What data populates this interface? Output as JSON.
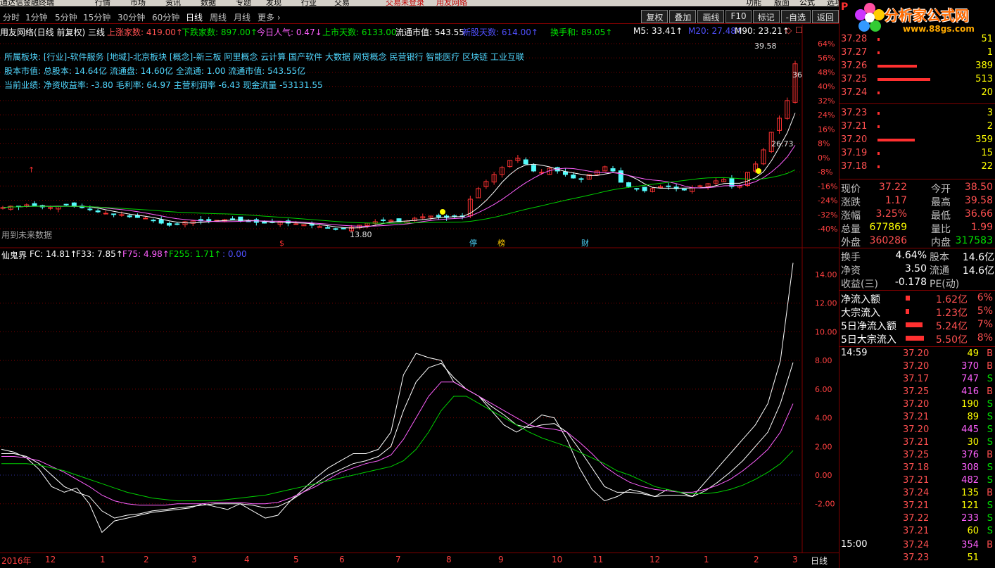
{
  "menubar": {
    "items": [
      {
        "label": "通达信金融终端",
        "color": "#000000"
      },
      {
        "label": "行情",
        "color": "#000000"
      },
      {
        "label": "市场",
        "color": "#000000"
      },
      {
        "label": "资讯",
        "color": "#000000"
      },
      {
        "label": "数据",
        "color": "#000000"
      },
      {
        "label": "专题",
        "color": "#000000"
      },
      {
        "label": "发现",
        "color": "#000000"
      },
      {
        "label": "行业",
        "color": "#000000"
      },
      {
        "label": "交易",
        "color": "#000000"
      },
      {
        "label": "交易未登录",
        "color": "#c00000"
      },
      {
        "label": "用友网络",
        "color": "#c00000"
      },
      {
        "label": "功能",
        "color": "#000000"
      },
      {
        "label": "版面",
        "color": "#000000"
      },
      {
        "label": "公式",
        "color": "#000000"
      },
      {
        "label": "选项",
        "color": "#000000"
      }
    ]
  },
  "periods": [
    "分时",
    "1分钟",
    "5分钟",
    "15分钟",
    "30分钟",
    "60分钟",
    "日线",
    "周线",
    "月线",
    "更多 ›"
  ],
  "active_period": "日线",
  "toolbar_buttons": [
    "复权",
    "叠加",
    "画线",
    "F10",
    "标记",
    "-自选",
    "返回"
  ],
  "main_header": [
    {
      "t": "用友网络(日线 前复权) 三线",
      "c": "white"
    },
    {
      "t": "上涨家数: 419.00↑",
      "c": "red"
    },
    {
      "t": "下跌家数: 897.00↑",
      "c": "green"
    },
    {
      "t": "今日人气: 0.47↓",
      "c": "magenta"
    },
    {
      "t": "上市天数: 6133.00",
      "c": "green"
    },
    {
      "t": "流通市值: 543.55",
      "c": "white"
    },
    {
      "t": "新股天数: 614.00↑",
      "c": "blue"
    },
    {
      "t": "换手和: 89.05↑",
      "c": "green"
    },
    {
      "t": "M5: 33.41↑",
      "c": "white"
    },
    {
      "t": "M20: 27.48↑",
      "c": "blue"
    },
    {
      "t": "M90: 23.21↑",
      "c": "white"
    }
  ],
  "info_lines": [
    "所属板块: [行业]-软件服务 [地域]-北京板块 [概念]-新三板 阿里概念 云计算 国产软件 大数据 网贷概念 民营银行 智能医疗 区块链 工业互联",
    "股本市值: 总股本: 14.64亿 流通盘: 14.60亿 全流通: 1.00 流通市值: 543.55亿",
    "当前业绩: 净资收益率: -3.80 毛利率: 64.97 主营利润率 -6.43 现金流量 -53131.55"
  ],
  "future_note": "用到未来数据",
  "price_labels": {
    "high": "39.58",
    "low": "13.80",
    "mid": "26.73",
    "right": "36"
  },
  "event_marks": [
    "$",
    "停",
    "榜",
    "财"
  ],
  "main_axis": [
    "64%",
    "56%",
    "48%",
    "40%",
    "32%",
    "24%",
    "16%",
    "8%",
    "0%",
    "-8%",
    "-16%",
    "-24%",
    "-32%",
    "-40%"
  ],
  "indicator_header": [
    {
      "t": "仙鬼界",
      "c": "white"
    },
    {
      "t": "FC: 14.81↑",
      "c": "white"
    },
    {
      "t": "F33: 7.85↑",
      "c": "white"
    },
    {
      "t": "F75: 4.98↑",
      "c": "magenta"
    },
    {
      "t": "F255: 1.71↑",
      "c": "green"
    },
    {
      "t": ": 0.00",
      "c": "blue"
    }
  ],
  "ind_axis": [
    "14.00",
    "12.00",
    "10.00",
    "8.00",
    "6.00",
    "4.00",
    "2.00",
    "0.00",
    "-2.00"
  ],
  "x_labels": [
    {
      "t": "2016年",
      "x": 0
    },
    {
      "t": "12",
      "x": 62
    },
    {
      "t": "1",
      "x": 140
    },
    {
      "t": "2",
      "x": 202
    },
    {
      "t": "3",
      "x": 270
    },
    {
      "t": "4",
      "x": 345
    },
    {
      "t": "5",
      "x": 415
    },
    {
      "t": "6",
      "x": 480
    },
    {
      "t": "7",
      "x": 560
    },
    {
      "t": "8",
      "x": 632
    },
    {
      "t": "9",
      "x": 706
    },
    {
      "t": "10",
      "x": 782
    },
    {
      "t": "11",
      "x": 840
    },
    {
      "t": "12",
      "x": 921
    },
    {
      "t": "1",
      "x": 998
    },
    {
      "t": "2",
      "x": 1069
    },
    {
      "t": "3",
      "x": 1124
    }
  ],
  "x_label_right": "日线",
  "logo_text": "分析家公式网",
  "logo_url": "www.88gs.com",
  "order_book": [
    {
      "p": "37.28",
      "v": "51",
      "bar": 0
    },
    {
      "p": "37.27",
      "v": "1",
      "bar": 0
    },
    {
      "p": "37.26",
      "v": "389",
      "bar": 75
    },
    {
      "p": "37.25",
      "v": "513",
      "bar": 100
    },
    {
      "p": "37.24",
      "v": "20",
      "bar": 4
    },
    {
      "p": "37.23",
      "v": "3",
      "bar": 0
    },
    {
      "p": "37.21",
      "v": "2",
      "bar": 0
    },
    {
      "p": "37.20",
      "v": "359",
      "bar": 70
    },
    {
      "p": "37.19",
      "v": "15",
      "bar": 3
    },
    {
      "p": "37.18",
      "v": "22",
      "bar": 4
    }
  ],
  "panel_logo_p": "P",
  "quote": [
    {
      "l1": "现价",
      "v1": "37.22",
      "c1": "red",
      "l2": "今开",
      "v2": "38.50",
      "c2": "red"
    },
    {
      "l1": "涨跌",
      "v1": "1.17",
      "c1": "red",
      "l2": "最高",
      "v2": "39.58",
      "c2": "red"
    },
    {
      "l1": "涨幅",
      "v1": "3.25%",
      "c1": "red",
      "l2": "最低",
      "v2": "36.66",
      "c2": "red"
    },
    {
      "l1": "总量",
      "v1": "677869",
      "c1": "yellow",
      "l2": "量比",
      "v2": "1.99",
      "c2": "red"
    },
    {
      "l1": "外盘",
      "v1": "360286",
      "c1": "red",
      "l2": "内盘",
      "v2": "317583",
      "c2": "green"
    }
  ],
  "stats": [
    {
      "l1": "换手",
      "v1": "4.64%",
      "l2": "股本",
      "v2": "14.6亿"
    },
    {
      "l1": "净资",
      "v1": "3.50",
      "l2": "流通",
      "v2": "14.6亿"
    },
    {
      "l1": "收益(三)",
      "v1": "-0.178",
      "l2": "PE(动)",
      "v2": ""
    }
  ],
  "flows": [
    {
      "l": "净流入额",
      "v": "1.62亿",
      "pct": "6%",
      "bar": 6
    },
    {
      "l": "大宗流入",
      "v": "1.23亿",
      "pct": "5%",
      "bar": 5
    },
    {
      "l": "5日净流入额",
      "v": "5.24亿",
      "pct": "7%",
      "bar": 24
    },
    {
      "l": "5日大宗流入",
      "v": "5.50亿",
      "pct": "8%",
      "bar": 26
    }
  ],
  "ticks_time1": "14:59",
  "ticks": [
    {
      "p": "37.20",
      "v": "49",
      "s": "B",
      "pc": "red",
      "vc": "yellow"
    },
    {
      "p": "37.20",
      "v": "370",
      "s": "B",
      "pc": "red",
      "vc": "magenta"
    },
    {
      "p": "37.17",
      "v": "747",
      "s": "S",
      "pc": "red",
      "vc": "magenta"
    },
    {
      "p": "37.25",
      "v": "416",
      "s": "B",
      "pc": "red",
      "vc": "magenta"
    },
    {
      "p": "37.20",
      "v": "190",
      "s": "S",
      "pc": "red",
      "vc": "yellow"
    },
    {
      "p": "37.21",
      "v": "89",
      "s": "S",
      "pc": "red",
      "vc": "yellow"
    },
    {
      "p": "37.20",
      "v": "445",
      "s": "S",
      "pc": "red",
      "vc": "magenta"
    },
    {
      "p": "37.21",
      "v": "30",
      "s": "S",
      "pc": "red",
      "vc": "yellow"
    },
    {
      "p": "37.25",
      "v": "376",
      "s": "B",
      "pc": "red",
      "vc": "magenta"
    },
    {
      "p": "37.18",
      "v": "308",
      "s": "S",
      "pc": "red",
      "vc": "magenta"
    },
    {
      "p": "37.21",
      "v": "482",
      "s": "S",
      "pc": "red",
      "vc": "magenta"
    },
    {
      "p": "37.24",
      "v": "135",
      "s": "B",
      "pc": "red",
      "vc": "yellow"
    },
    {
      "p": "37.21",
      "v": "121",
      "s": "S",
      "pc": "red",
      "vc": "yellow"
    },
    {
      "p": "37.22",
      "v": "233",
      "s": "S",
      "pc": "red",
      "vc": "magenta"
    },
    {
      "p": "37.21",
      "v": "60",
      "s": "S",
      "pc": "red",
      "vc": "yellow"
    }
  ],
  "ticks_time2": "15:00",
  "ticks2": [
    {
      "p": "37.24",
      "v": "354",
      "s": "B",
      "pc": "red",
      "vc": "magenta"
    },
    {
      "p": "37.23",
      "v": "51",
      "s": "",
      "pc": "red",
      "vc": "yellow"
    }
  ],
  "colors": {
    "up": "#ff3232",
    "down": "#54fcfc",
    "ma_pink": "#ff60ff",
    "ma_green": "#00d000",
    "grid": "#800000"
  },
  "chart_data": {
    "type": "candlestick",
    "price_range": [
      13.8,
      39.58
    ],
    "close_series": [
      16.8,
      17.0,
      16.9,
      17.2,
      17.1,
      16.9,
      16.8,
      17.0,
      17.2,
      17.0,
      16.8,
      16.5,
      16.2,
      16.0,
      15.9,
      15.8,
      15.5,
      15.4,
      15.3,
      15.0,
      14.6,
      14.3,
      14.5,
      14.8,
      14.9,
      14.9,
      14.9,
      15.0,
      15.1,
      15.2,
      14.9,
      14.8,
      14.7,
      14.6,
      14.7,
      14.8,
      14.6,
      14.5,
      14.4,
      14.3,
      14.1,
      13.9,
      13.7,
      13.8,
      14.0,
      14.3,
      14.6,
      14.8,
      15.0,
      15.0,
      14.8,
      14.9,
      15.3,
      15.5,
      15.6,
      15.5,
      15.4,
      15.5,
      15.6,
      18.0,
      19.5,
      20.5,
      21.5,
      22.5,
      23.5,
      23.8,
      23.0,
      22.0,
      21.8,
      22.4,
      22.0,
      21.5,
      21.0,
      20.8,
      21.5,
      22.0,
      22.6,
      22.0,
      20.4,
      19.8,
      19.5,
      19.2,
      19.5,
      19.8,
      19.8,
      19.5,
      19.3,
      19.6,
      19.9,
      20.2,
      20.6,
      20.8,
      19.8,
      19.9,
      21.8,
      23.0,
      25.0,
      27.5,
      29.5,
      32.0,
      37.22
    ],
    "ylim": [
      -40,
      64
    ],
    "indicator": {
      "name": "仙鬼界",
      "ylim": [
        -2,
        14
      ],
      "FC": [
        1.8,
        1.6,
        1.2,
        0.4,
        -0.8,
        -1.2,
        -0.9,
        -2.0,
        -4.0,
        -3.2,
        -3.0,
        -2.8,
        -2.6,
        -2.5,
        -2.4,
        -2.3,
        -2.0,
        -2.2,
        -2.4,
        -2.0,
        -2.5,
        -3.0,
        -2.8,
        -1.8,
        -1.0,
        -0.2,
        0.5,
        1.0,
        1.5,
        1.5,
        1.8,
        3.0,
        7.0,
        8.5,
        8.2,
        8.0,
        6.5,
        6.0,
        5.5,
        4.5,
        3.5,
        3.0,
        3.5,
        4.2,
        4.0,
        2.5,
        0.5,
        -1.0,
        -1.8,
        -1.5,
        -1.0,
        -1.2,
        -1.5,
        -1.0,
        -1.2,
        -1.5,
        -0.5,
        0.5,
        1.5,
        2.5,
        3.5,
        5.0,
        8.0,
        14.81
      ],
      "F33": [
        1.5,
        1.5,
        1.3,
        0.8,
        0,
        -0.8,
        -1.2,
        -1.5,
        -2.5,
        -3.0,
        -2.8,
        -2.7,
        -2.5,
        -2.4,
        -2.3,
        -2.2,
        -2.1,
        -2.0,
        -2.0,
        -2.0,
        -2.1,
        -2.3,
        -2.2,
        -1.8,
        -1.2,
        -0.6,
        0,
        0.4,
        0.8,
        1.0,
        1.3,
        2.0,
        4.5,
        6.5,
        7.5,
        7.8,
        6.8,
        6.0,
        5.5,
        4.8,
        4.2,
        3.5,
        3.3,
        3.5,
        3.6,
        3.0,
        1.8,
        0.5,
        -0.8,
        -1.2,
        -1.2,
        -1.3,
        -1.5,
        -1.4,
        -1.4,
        -1.5,
        -1.1,
        -0.5,
        0.2,
        1.0,
        2.0,
        3.0,
        5.0,
        7.85
      ],
      "F75": [
        1.3,
        1.3,
        1.2,
        1.0,
        0.6,
        0.2,
        -0.3,
        -0.8,
        -1.4,
        -1.8,
        -2.0,
        -2.1,
        -2.1,
        -2.1,
        -2.0,
        -2.0,
        -2.0,
        -1.9,
        -1.9,
        -1.9,
        -2.0,
        -2.0,
        -1.9,
        -1.6,
        -1.2,
        -0.8,
        -0.3,
        0.2,
        0.5,
        0.8,
        1.0,
        1.4,
        2.5,
        4.0,
        5.5,
        6.5,
        6.5,
        6.0,
        5.5,
        5.0,
        4.5,
        4.0,
        3.5,
        3.3,
        3.2,
        3.0,
        2.3,
        1.5,
        0.6,
        0,
        -0.5,
        -0.8,
        -1.0,
        -1.1,
        -1.2,
        -1.2,
        -1.0,
        -0.7,
        -0.3,
        0.3,
        1.0,
        1.8,
        3.0,
        4.98
      ],
      "F255": [
        0.8,
        0.8,
        0.8,
        0.7,
        0.5,
        0.3,
        0,
        -0.3,
        -0.6,
        -0.9,
        -1.2,
        -1.4,
        -1.6,
        -1.7,
        -1.8,
        -1.8,
        -1.8,
        -1.8,
        -1.7,
        -1.6,
        -1.5,
        -1.4,
        -1.2,
        -1.0,
        -0.8,
        -0.6,
        -0.4,
        -0.2,
        0,
        0.2,
        0.4,
        0.6,
        1.0,
        1.8,
        3.0,
        4.5,
        5.5,
        5.5,
        5.0,
        4.5,
        4.0,
        3.5,
        3.0,
        2.6,
        2.3,
        2.0,
        1.6,
        1.2,
        0.8,
        0.3,
        0,
        -0.4,
        -0.8,
        -1.0,
        -1.2,
        -1.3,
        -1.3,
        -1.2,
        -1.0,
        -0.7,
        -0.3,
        0.2,
        0.8,
        1.71
      ]
    }
  }
}
